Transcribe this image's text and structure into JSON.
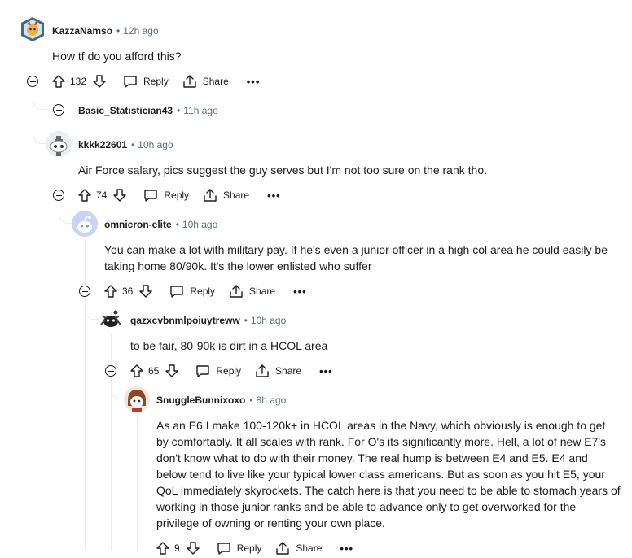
{
  "colors": {
    "thread_line": "#e5ebee",
    "muted": "#576f76",
    "text": "#1c1c1c"
  },
  "comments": [
    {
      "author": "KazzaNamso",
      "time": "12h ago",
      "body": "How tf do you afford this?",
      "votes": "132"
    },
    {
      "author": "Basic_Statistician43",
      "time": "11h ago",
      "collapsed": true
    },
    {
      "author": "kkkk22601",
      "time": "10h ago",
      "body": "Air Force salary, pics suggest the guy serves but I'm not too sure on the rank tho.",
      "votes": "74"
    },
    {
      "author": "omnicron-elite",
      "time": "10h ago",
      "body": "You can make a lot with military pay. If he's even a junior officer in a high col area he could easily be taking home 80/90k. It's the lower enlisted who suffer",
      "votes": "36"
    },
    {
      "author": "qazxcvbnmlpoiuytreww",
      "time": "10h ago",
      "body": "to be fair, 80-90k is dirt in a HCOL area",
      "votes": "65"
    },
    {
      "author": "SnuggleBunnixoxo",
      "time": "8h ago",
      "body": "As an E6 I make 100-120k+ in HCOL areas in the Navy, which obviously is enough to get by comfortably. It all scales with rank. For O's its significantly more. Hell, a lot of new E7's don't know what to do with their money. The real hump is between E4 and E5. E4 and below tend to live like your typical lower class americans. But as soon as you hit E5, your QoL immediately skyrockets. The catch here is that you need to be able to stomach years of working in those junior ranks and be able to advance only to get overworked for the privilege of owning or renting your own place.",
      "votes": "9"
    }
  ],
  "labels": {
    "reply": "Reply",
    "share": "Share",
    "more": "•••",
    "dot": "•"
  }
}
